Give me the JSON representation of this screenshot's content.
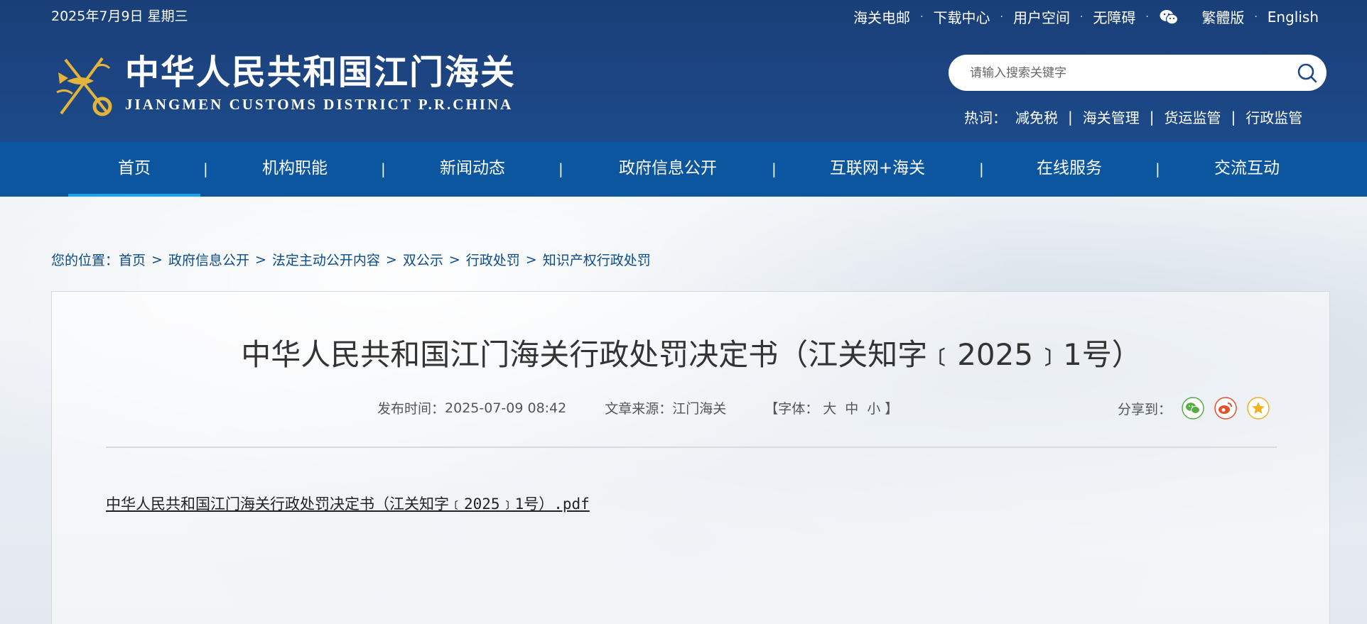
{
  "header": {
    "date": "2025年7月9日 星期三",
    "top_links": [
      "海关电邮",
      "下载中心",
      "用户空间",
      "无障碍",
      "繁體版",
      "English"
    ],
    "logo_cn": "中华人民共和国江门海关",
    "logo_en": "JIANGMEN CUSTOMS DISTRICT P.R.CHINA",
    "search_placeholder": "请输入搜索关键字",
    "hotwords_label": "热词：",
    "hotwords": [
      "减免税",
      "海关管理",
      "货运监管",
      "行政监管"
    ]
  },
  "nav": {
    "items": [
      "首页",
      "机构职能",
      "新闻动态",
      "政府信息公开",
      "互联网+海关",
      "在线服务",
      "交流互动"
    ],
    "active": "首页"
  },
  "breadcrumb": {
    "label": "您的位置：",
    "items": [
      "首页",
      "政府信息公开",
      "法定主动公开内容",
      "双公示",
      "行政处罚",
      "知识产权行政处罚"
    ]
  },
  "article": {
    "title": "中华人民共和国江门海关行政处罚决定书（江关知字﹝2025﹞1号）",
    "publish_label": "发布时间：",
    "publish_time": "2025-07-09 08:42",
    "source_label": "文章来源：",
    "source": "江门海关",
    "font_open": "【字体：",
    "font_large": "大",
    "font_medium": "中",
    "font_small": "小",
    "font_close": "】",
    "share_label": "分享到：",
    "attachment": "中华人民共和国江门海关行政处罚决定书（江关知字﹝2025﹞1号）.pdf"
  },
  "colors": {
    "header_bg": "#1c4582",
    "nav_bg": "#0c56a0",
    "active_underline": "#1aa3f0",
    "breadcrumb": "#0c4a8a",
    "wechat": "#52b043",
    "weibo": "#e6512b",
    "favorite": "#f2b01e"
  }
}
